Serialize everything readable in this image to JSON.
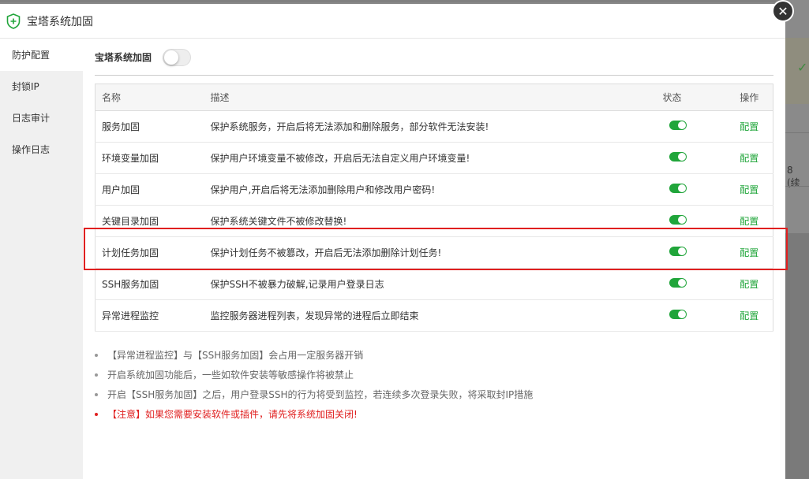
{
  "dialog": {
    "title": "宝塔系统加固"
  },
  "sidebar": {
    "items": [
      {
        "label": "防护配置"
      },
      {
        "label": "封锁IP"
      },
      {
        "label": "日志审计"
      },
      {
        "label": "操作日志"
      }
    ]
  },
  "main": {
    "master_toggle_label": "宝塔系统加固",
    "master_toggle_on": false,
    "table": {
      "headers": {
        "name": "名称",
        "desc": "描述",
        "state": "状态",
        "op": "操作"
      },
      "rows": [
        {
          "name": "服务加固",
          "desc": "保护系统服务，开启后将无法添加和删除服务，部分软件无法安装!",
          "enabled": true,
          "action": "配置"
        },
        {
          "name": "环境变量加固",
          "desc": "保护用户环境变量不被修改，开启后无法自定义用户环境变量!",
          "enabled": true,
          "action": "配置"
        },
        {
          "name": "用户加固",
          "desc": "保护用户,开启后将无法添加删除用户和修改用户密码!",
          "enabled": true,
          "action": "配置"
        },
        {
          "name": "关键目录加固",
          "desc": "保护系统关键文件不被修改替换!",
          "enabled": true,
          "action": "配置"
        },
        {
          "name": "计划任务加固",
          "desc": "保护计划任务不被篡改，开启后无法添加删除计划任务!",
          "enabled": true,
          "action": "配置"
        },
        {
          "name": "SSH服务加固",
          "desc": "保护SSH不被暴力破解,记录用户登录日志",
          "enabled": true,
          "action": "配置"
        },
        {
          "name": "异常进程监控",
          "desc": "监控服务器进程列表，发现异常的进程后立即结束",
          "enabled": true,
          "action": "配置"
        }
      ]
    },
    "notes": [
      "【异常进程监控】与【SSH服务加固】会占用一定服务器开销",
      "开启系统加固功能后，一些如软件安装等敏感操作将被禁止",
      "开启【SSH服务加固】之后，用户登录SSH的行为将受到监控，若连续多次登录失败，将采取封IP措施"
    ],
    "warning": "【注意】如果您需要安装软件或插件，请先将系统加固关闭!"
  },
  "background": {
    "partial_text": "8 (续"
  },
  "colors": {
    "accent_green": "#20a53a",
    "warning_red": "#e02020"
  }
}
